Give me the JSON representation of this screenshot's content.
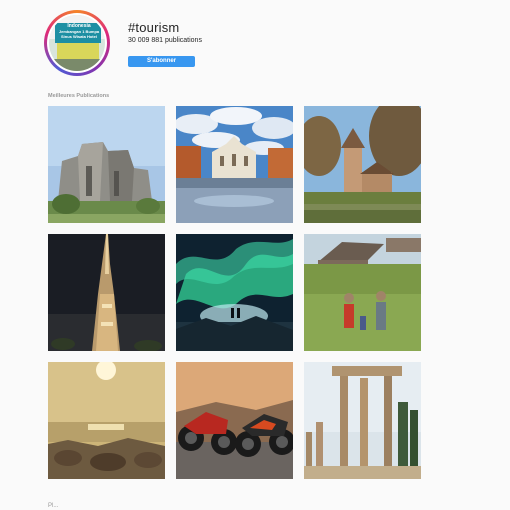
{
  "profile": {
    "avatar_line1": "Indonesia",
    "avatar_line2": "Jembangan 1 Bumpa",
    "avatar_line3": "Sinus Wisata Hotel",
    "hashtag": "#tourism",
    "publications": "30 009 881 publications",
    "follow_label": "S'abonner"
  },
  "top_posts_label": "Meilleures Publications",
  "bottom_label": "Pl...",
  "posts": [
    {
      "name": "post-modern-concrete-building"
    },
    {
      "name": "post-cathedral-piazza-clouds"
    },
    {
      "name": "post-castle-tower-lake"
    },
    {
      "name": "post-burj-khalifa-night"
    },
    {
      "name": "post-aurora-borealis"
    },
    {
      "name": "post-hikers-cabin-meadow"
    },
    {
      "name": "post-sunset-rocky-shore"
    },
    {
      "name": "post-motorcycles-desert"
    },
    {
      "name": "post-ancient-ruins-columns"
    }
  ]
}
